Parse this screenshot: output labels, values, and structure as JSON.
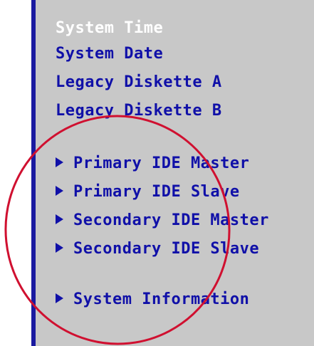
{
  "menu": {
    "items": [
      {
        "label": "System Time",
        "selected": true
      },
      {
        "label": "System Date"
      },
      {
        "label": "Legacy Diskette A"
      },
      {
        "label": "Legacy Diskette B"
      }
    ],
    "submenus": [
      {
        "label": "Primary IDE Master"
      },
      {
        "label": "Primary IDE Slave"
      },
      {
        "label": "Secondary IDE Master"
      },
      {
        "label": "Secondary IDE Slave"
      },
      {
        "label": "System Information"
      }
    ]
  },
  "colors": {
    "panel": "#c8c8c8",
    "border": "#1a1aa0",
    "text": "#1010a8",
    "selected_text": "#ffffff",
    "annotation": "#d01030"
  },
  "icons": {
    "submenu": "right-triangle-icon"
  }
}
